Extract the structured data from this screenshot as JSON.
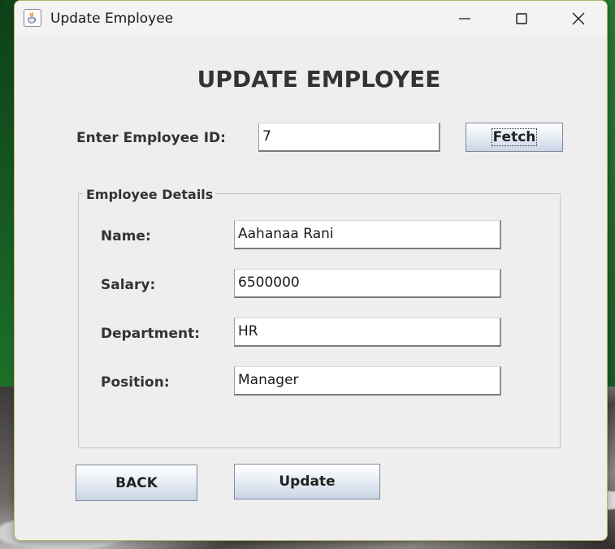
{
  "window": {
    "title": "Update Employee",
    "icon": "java-coffee-icon",
    "controls": [
      "minimize-icon",
      "maximize-icon",
      "close-icon"
    ]
  },
  "heading": "UPDATE EMPLOYEE",
  "lookup": {
    "label": "Enter Employee ID:",
    "value": "7",
    "fetch_label": "Fetch"
  },
  "details": {
    "title": "Employee Details",
    "name_label": "Name:",
    "name_value": "Aahanaa Rani",
    "salary_label": "Salary:",
    "salary_value": "6500000",
    "department_label": "Department:",
    "department_value": "HR",
    "position_label": "Position:",
    "position_value": "Manager"
  },
  "actions": {
    "back_label": "BACK",
    "update_label": "Update"
  },
  "colors": {
    "window_bg": "#eeeeee",
    "button_gradient_bottom": "#c9d5e6",
    "group_border": "#b8c8d8",
    "text": "#333333"
  }
}
